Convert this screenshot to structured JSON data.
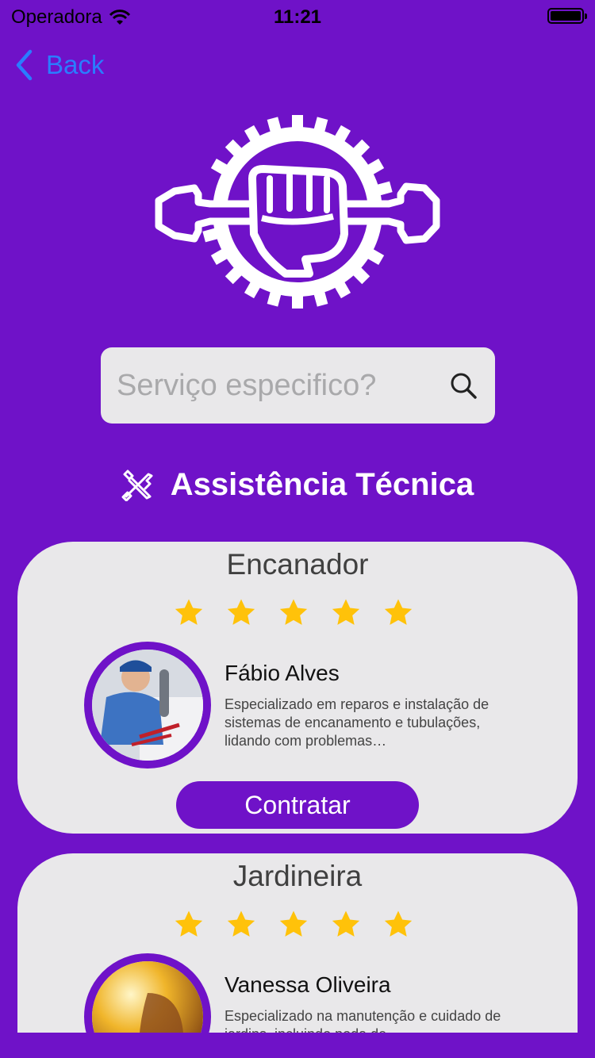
{
  "status_bar": {
    "carrier": "Operadora",
    "time": "11:21"
  },
  "nav": {
    "back_label": "Back"
  },
  "search": {
    "placeholder": "Serviço especifico?"
  },
  "section": {
    "title": "Assistência Técnica"
  },
  "colors": {
    "brand_purple": "#6f12c8",
    "card_bg": "#e9e8ea",
    "star_yellow": "#ffc20a",
    "link_blue": "#2a7dff"
  },
  "cards": [
    {
      "category": "Encanador",
      "rating": 5,
      "name": "Fábio Alves",
      "description": "Especializado em reparos e instalação de sistemas de encanamento e tubulações, lidando com problemas…",
      "hire_label": "Contratar"
    },
    {
      "category": "Jardineira",
      "rating": 5,
      "name": "Vanessa Oliveira",
      "description": "Especializado na manutenção e cuidado de jardins, incluindo poda de"
    }
  ]
}
